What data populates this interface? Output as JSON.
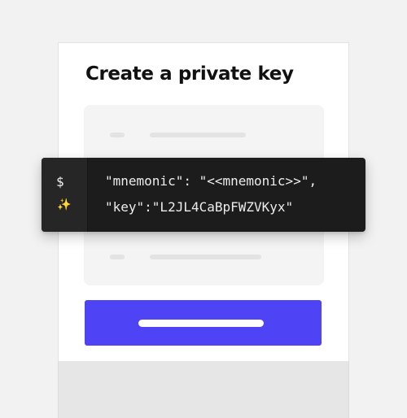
{
  "card": {
    "title": "Create a private key"
  },
  "code": {
    "prompt_symbol": "$",
    "line_icon": "sparkles-icon",
    "line_icon_glyph": "✨",
    "lines": [
      "\"mnemonic\": \"<<mnemonic>>\",",
      "\"key\":\"L2JL4CaBpFWZVKyx\""
    ]
  },
  "colors": {
    "page_background": "#f2f2f2",
    "card_background": "#ffffff",
    "code_background": "#1c1c1c",
    "button_accent": "#4e43f5",
    "placeholder": "#e3e3e3"
  }
}
